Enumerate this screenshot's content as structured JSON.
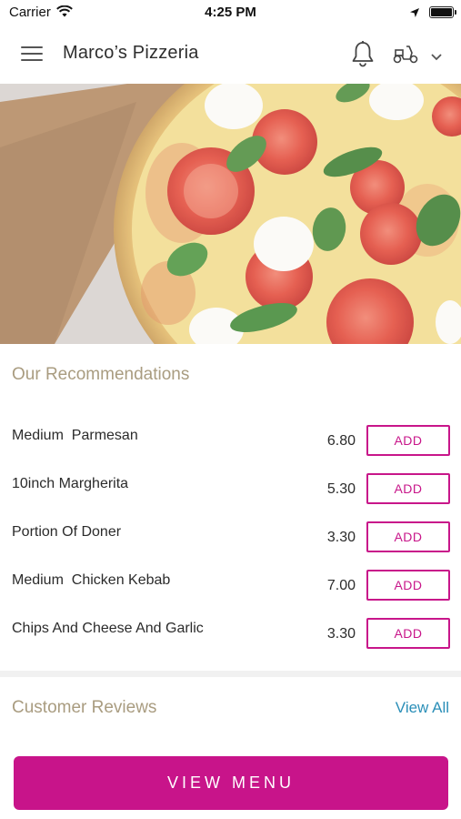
{
  "status_bar": {
    "carrier": "Carrier",
    "time": "4:25 PM"
  },
  "header": {
    "title": "Marco’s Pizzeria",
    "icons": [
      "menu-icon",
      "bell-icon",
      "scooter-icon",
      "chevron-down-icon"
    ]
  },
  "hero": {
    "image": "margherita-pizza-photo"
  },
  "recommendations": {
    "title": "Our Recommendations",
    "items": [
      {
        "name": "Medium  Parmesan",
        "price": "6.80",
        "action": "ADD"
      },
      {
        "name": "10inch Margherita",
        "price": "5.30",
        "action": "ADD"
      },
      {
        "name": "Portion Of Doner",
        "price": "3.30",
        "action": "ADD"
      },
      {
        "name": "Medium  Chicken Kebab",
        "price": "7.00",
        "action": "ADD"
      },
      {
        "name": "Chips And Cheese And Garlic",
        "price": "3.30",
        "action": "ADD"
      }
    ]
  },
  "reviews": {
    "title": "Customer Reviews",
    "view_all": "View All"
  },
  "footer": {
    "view_menu": "VIEW MENU"
  },
  "colors": {
    "accent": "#c8148a",
    "section_title": "#a99c80",
    "link": "#2b8fb8"
  }
}
